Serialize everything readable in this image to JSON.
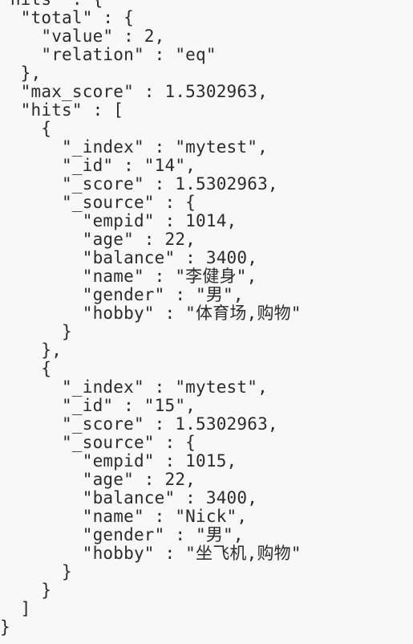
{
  "lines": [
    "\"hits\" : {",
    "  \"total\" : {",
    "    \"value\" : 2,",
    "    \"relation\" : \"eq\"",
    "  },",
    "  \"max_score\" : 1.5302963,",
    "  \"hits\" : [",
    "    {",
    "      \"_index\" : \"mytest\",",
    "      \"_id\" : \"14\",",
    "      \"_score\" : 1.5302963,",
    "      \"_source\" : {",
    "        \"empid\" : 1014,",
    "        \"age\" : 22,",
    "        \"balance\" : 3400,",
    "        \"name\" : \"李健身\",",
    "        \"gender\" : \"男\",",
    "        \"hobby\" : \"体育场,购物\"",
    "      }",
    "    },",
    "    {",
    "      \"_index\" : \"mytest\",",
    "      \"_id\" : \"15\",",
    "      \"_score\" : 1.5302963,",
    "      \"_source\" : {",
    "        \"empid\" : 1015,",
    "        \"age\" : 22,",
    "        \"balance\" : 3400,",
    "        \"name\" : \"Nick\",",
    "        \"gender\" : \"男\",",
    "        \"hobby\" : \"坐飞机,购物\"",
    "      }",
    "    }",
    "  ]",
    "}"
  ]
}
